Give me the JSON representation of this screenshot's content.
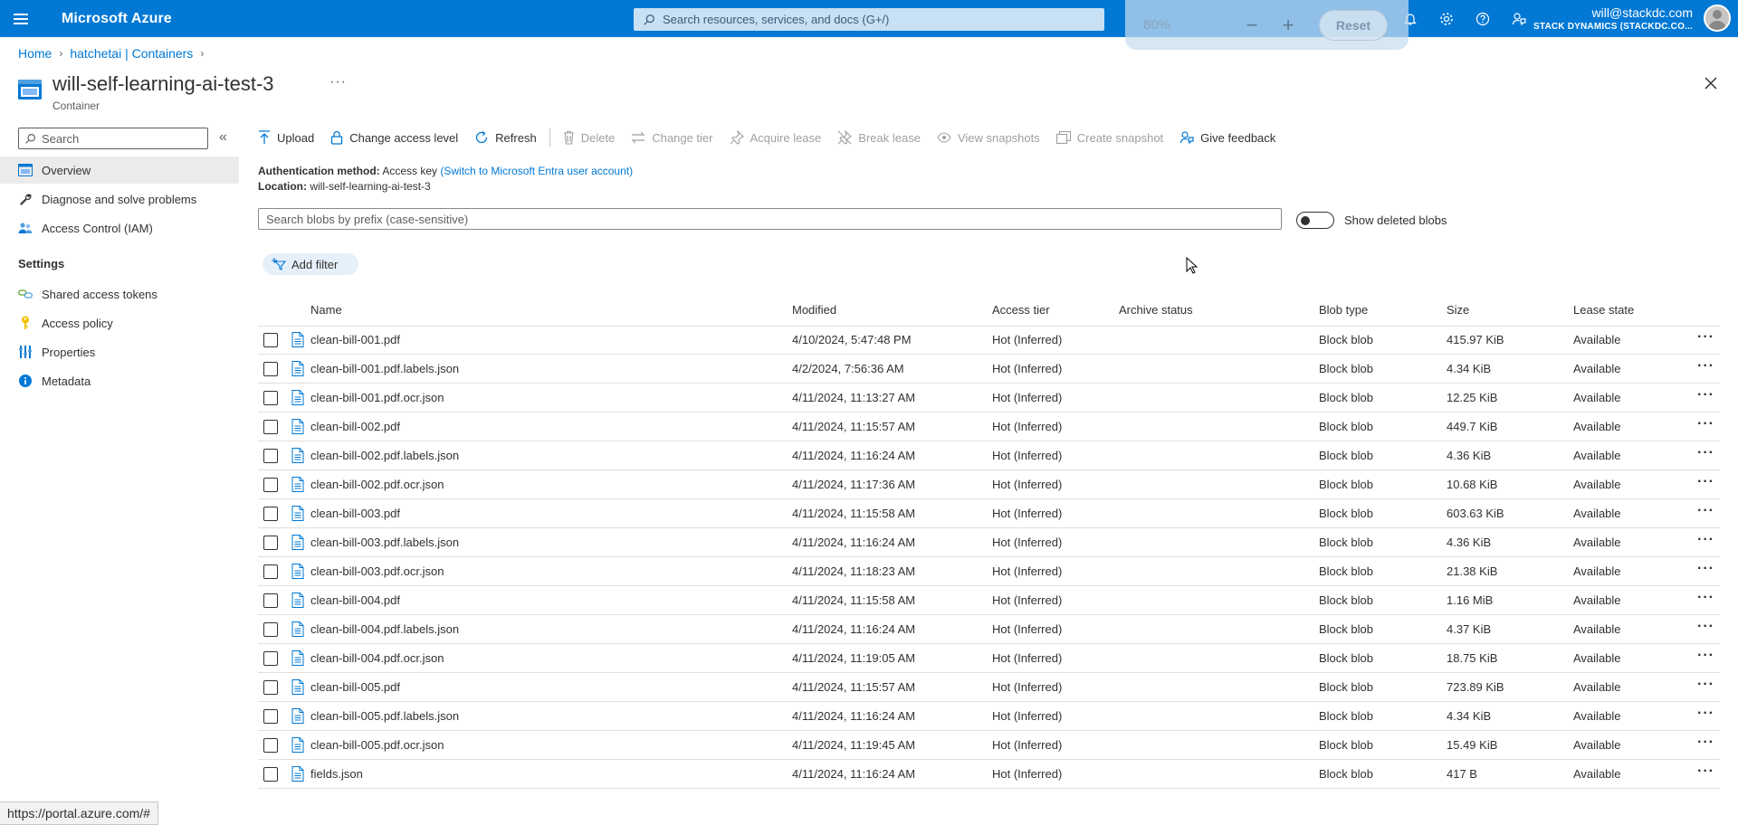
{
  "topbar": {
    "brand": "Microsoft Azure",
    "search_placeholder": "Search resources, services, and docs (G+/)",
    "user_email": "will@stackdc.com",
    "user_org": "STACK DYNAMICS (STACKDC.CO..."
  },
  "zoom": {
    "level": "80%",
    "minus": "−",
    "plus": "+",
    "reset": "Reset"
  },
  "breadcrumb": {
    "home": "Home",
    "containers": "hatchetai | Containers"
  },
  "header": {
    "title": "will-self-learning-ai-test-3",
    "subtitle": "Container",
    "more": "···"
  },
  "sidebar": {
    "search_placeholder": "Search",
    "collapse": "«",
    "items": [
      {
        "label": "Overview"
      },
      {
        "label": "Diagnose and solve problems"
      },
      {
        "label": "Access Control (IAM)"
      }
    ],
    "settings_heading": "Settings",
    "settings_items": [
      {
        "label": "Shared access tokens"
      },
      {
        "label": "Access policy"
      },
      {
        "label": "Properties"
      },
      {
        "label": "Metadata"
      }
    ]
  },
  "toolbar": {
    "upload": "Upload",
    "change_access": "Change access level",
    "refresh": "Refresh",
    "delete": "Delete",
    "change_tier": "Change tier",
    "acquire_lease": "Acquire lease",
    "break_lease": "Break lease",
    "view_snapshots": "View snapshots",
    "create_snapshot": "Create snapshot",
    "feedback": "Give feedback"
  },
  "info": {
    "auth_label": "Authentication method:",
    "auth_value": "Access key",
    "auth_link": "(Switch to Microsoft Entra user account)",
    "location_label": "Location:",
    "location_value": "will-self-learning-ai-test-3"
  },
  "blob_search_placeholder": "Search blobs by prefix (case-sensitive)",
  "show_deleted": "Show deleted blobs",
  "add_filter": "Add filter",
  "table": {
    "headers": {
      "name": "Name",
      "modified": "Modified",
      "tier": "Access tier",
      "archive": "Archive status",
      "type": "Blob type",
      "size": "Size",
      "lease": "Lease state"
    },
    "rows": [
      {
        "name": "clean-bill-001.pdf",
        "modified": "4/10/2024, 5:47:48 PM",
        "tier": "Hot (Inferred)",
        "type": "Block blob",
        "size": "415.97 KiB",
        "lease": "Available"
      },
      {
        "name": "clean-bill-001.pdf.labels.json",
        "modified": "4/2/2024, 7:56:36 AM",
        "tier": "Hot (Inferred)",
        "type": "Block blob",
        "size": "4.34 KiB",
        "lease": "Available"
      },
      {
        "name": "clean-bill-001.pdf.ocr.json",
        "modified": "4/11/2024, 11:13:27 AM",
        "tier": "Hot (Inferred)",
        "type": "Block blob",
        "size": "12.25 KiB",
        "lease": "Available"
      },
      {
        "name": "clean-bill-002.pdf",
        "modified": "4/11/2024, 11:15:57 AM",
        "tier": "Hot (Inferred)",
        "type": "Block blob",
        "size": "449.7 KiB",
        "lease": "Available"
      },
      {
        "name": "clean-bill-002.pdf.labels.json",
        "modified": "4/11/2024, 11:16:24 AM",
        "tier": "Hot (Inferred)",
        "type": "Block blob",
        "size": "4.36 KiB",
        "lease": "Available"
      },
      {
        "name": "clean-bill-002.pdf.ocr.json",
        "modified": "4/11/2024, 11:17:36 AM",
        "tier": "Hot (Inferred)",
        "type": "Block blob",
        "size": "10.68 KiB",
        "lease": "Available"
      },
      {
        "name": "clean-bill-003.pdf",
        "modified": "4/11/2024, 11:15:58 AM",
        "tier": "Hot (Inferred)",
        "type": "Block blob",
        "size": "603.63 KiB",
        "lease": "Available"
      },
      {
        "name": "clean-bill-003.pdf.labels.json",
        "modified": "4/11/2024, 11:16:24 AM",
        "tier": "Hot (Inferred)",
        "type": "Block blob",
        "size": "4.36 KiB",
        "lease": "Available"
      },
      {
        "name": "clean-bill-003.pdf.ocr.json",
        "modified": "4/11/2024, 11:18:23 AM",
        "tier": "Hot (Inferred)",
        "type": "Block blob",
        "size": "21.38 KiB",
        "lease": "Available"
      },
      {
        "name": "clean-bill-004.pdf",
        "modified": "4/11/2024, 11:15:58 AM",
        "tier": "Hot (Inferred)",
        "type": "Block blob",
        "size": "1.16 MiB",
        "lease": "Available"
      },
      {
        "name": "clean-bill-004.pdf.labels.json",
        "modified": "4/11/2024, 11:16:24 AM",
        "tier": "Hot (Inferred)",
        "type": "Block blob",
        "size": "4.37 KiB",
        "lease": "Available"
      },
      {
        "name": "clean-bill-004.pdf.ocr.json",
        "modified": "4/11/2024, 11:19:05 AM",
        "tier": "Hot (Inferred)",
        "type": "Block blob",
        "size": "18.75 KiB",
        "lease": "Available"
      },
      {
        "name": "clean-bill-005.pdf",
        "modified": "4/11/2024, 11:15:57 AM",
        "tier": "Hot (Inferred)",
        "type": "Block blob",
        "size": "723.89 KiB",
        "lease": "Available"
      },
      {
        "name": "clean-bill-005.pdf.labels.json",
        "modified": "4/11/2024, 11:16:24 AM",
        "tier": "Hot (Inferred)",
        "type": "Block blob",
        "size": "4.34 KiB",
        "lease": "Available"
      },
      {
        "name": "clean-bill-005.pdf.ocr.json",
        "modified": "4/11/2024, 11:19:45 AM",
        "tier": "Hot (Inferred)",
        "type": "Block blob",
        "size": "15.49 KiB",
        "lease": "Available"
      },
      {
        "name": "fields.json",
        "modified": "4/11/2024, 11:16:24 AM",
        "tier": "Hot (Inferred)",
        "type": "Block blob",
        "size": "417 B",
        "lease": "Available"
      }
    ]
  },
  "status_url": "https://portal.azure.com/#",
  "colors": {
    "accent": "#0078d4",
    "search_bg": "#c7e0f4"
  }
}
